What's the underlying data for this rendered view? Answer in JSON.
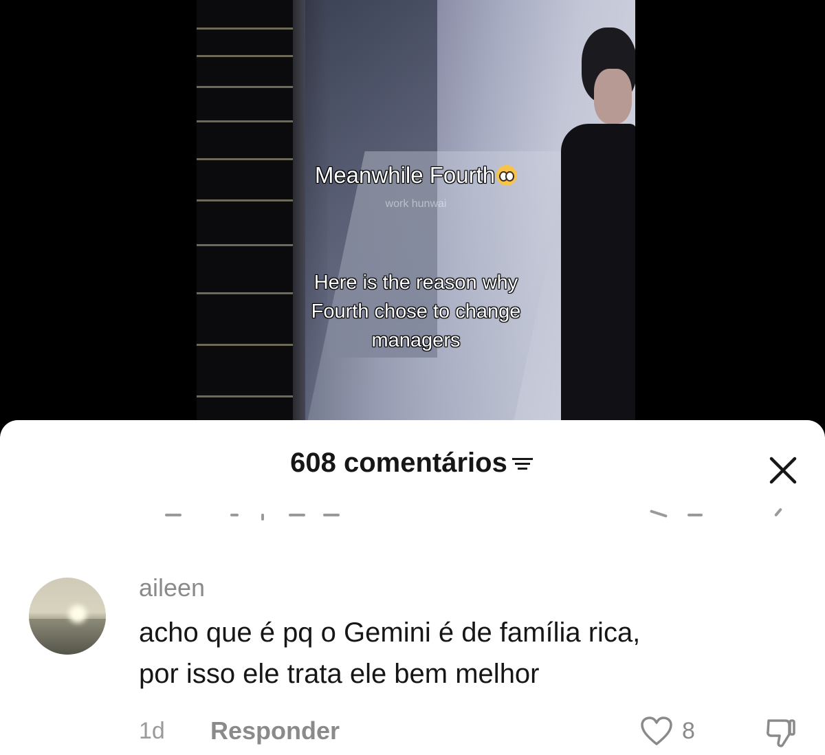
{
  "video": {
    "caption_top": "Meanwhile Fourth",
    "caption_emoji": "pleading-face-emoji",
    "watermark": "work hunwai",
    "caption_bottom_lines": [
      "Here is the reason why",
      "Fourth chose to change",
      "managers"
    ]
  },
  "comments_sheet": {
    "title": "608 comentários",
    "filter_icon": "filter-icon",
    "close_icon": "close-icon"
  },
  "comment": {
    "username": "aileen",
    "text_lines": [
      "acho que é pq o Gemini é de família rica,",
      "por isso ele trata ele bem melhor"
    ],
    "time": "1d",
    "reply_label": "Responder",
    "like_count": "8",
    "like_icon": "heart-icon",
    "dislike_icon": "thumbs-down-icon"
  }
}
